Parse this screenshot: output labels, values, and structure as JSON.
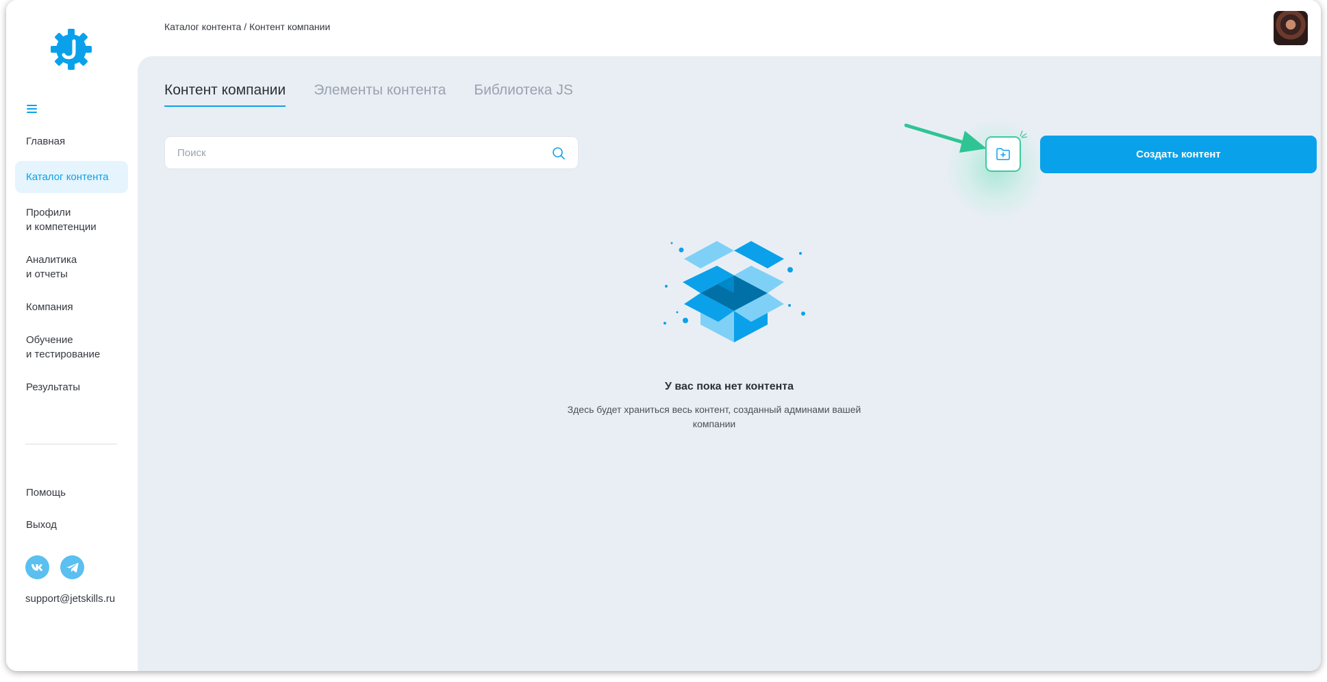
{
  "breadcrumb": {
    "catalog": "Каталог контента",
    "separator": " / ",
    "current": "Контент компании"
  },
  "sidebar": {
    "items": [
      {
        "label": "Главная",
        "active": false
      },
      {
        "label": "Каталог контента",
        "active": true
      },
      {
        "label": "Профили\nи компетенции",
        "active": false
      },
      {
        "label": "Аналитика\nи отчеты",
        "active": false
      },
      {
        "label": "Компания",
        "active": false
      },
      {
        "label": "Обучение\nи тестирование",
        "active": false
      },
      {
        "label": "Результаты",
        "active": false
      }
    ],
    "bottom_items": [
      {
        "label": "Помощь"
      },
      {
        "label": "Выход"
      }
    ],
    "socials": [
      "vk-icon",
      "telegram-icon"
    ],
    "support_email": "support@jetskills.ru"
  },
  "tabs": [
    {
      "label": "Контент компании",
      "active": true
    },
    {
      "label": "Элементы контента",
      "active": false
    },
    {
      "label": "Библиотека JS",
      "active": false
    }
  ],
  "search": {
    "placeholder": "Поиск",
    "value": ""
  },
  "toolbar": {
    "create_label": "Создать контент",
    "folder_icon": "folder-plus-icon"
  },
  "empty_state": {
    "title": "У вас пока нет контента",
    "text": "Здесь будет храниться весь контент, созданный админами вашей компании"
  },
  "colors": {
    "accent": "#09a2ea",
    "highlight": "#3cc9a0",
    "background": "#e9eef5"
  }
}
